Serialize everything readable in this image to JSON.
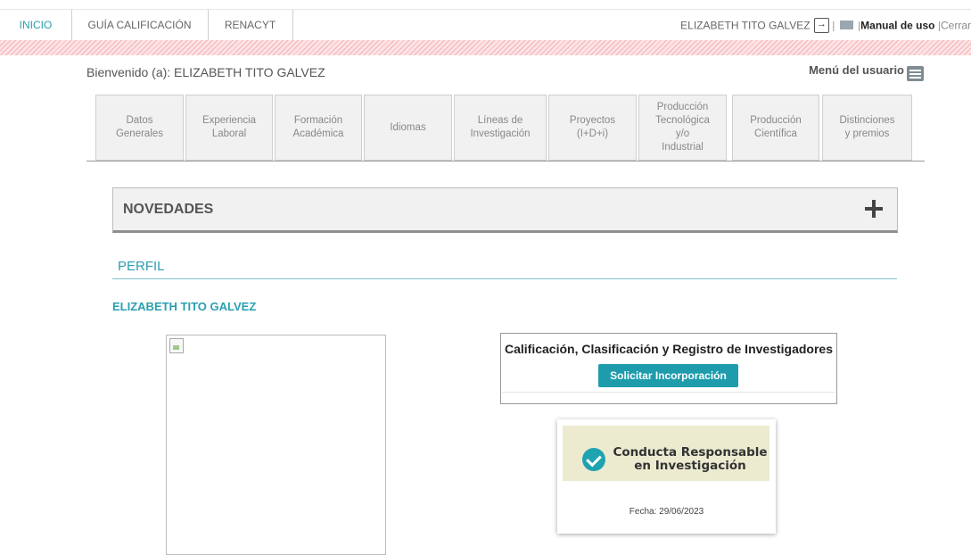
{
  "topnav": {
    "tabs": [
      "INICIO",
      "GUÍA CALIFICACIÓN",
      "RENACYT"
    ],
    "user_name": "ELIZABETH TITO GALVEZ",
    "manual": "Manual de uso",
    "close": "Cerrar"
  },
  "header": {
    "welcome": "Bienvenido (a): ELIZABETH TITO GALVEZ",
    "user_menu": "Menú del usuario"
  },
  "section_tabs": [
    {
      "line1": "Datos",
      "line2": "Generales"
    },
    {
      "line1": "Experiencia",
      "line2": "Laboral"
    },
    {
      "line1": "Formación",
      "line2": "Académica"
    },
    {
      "line1": "Idiomas",
      "line2": ""
    },
    {
      "line1": "Líneas de",
      "line2": "Investigación"
    },
    {
      "line1": "Proyectos",
      "line2": "(I+D+i)"
    },
    {
      "line1": "Producción",
      "line2": "Tecnológica",
      "line3": "y/o",
      "line4": "Industrial"
    },
    {
      "line1": "Producción",
      "line2": "Científica"
    },
    {
      "line1": "Distinciones",
      "line2": "y premios"
    }
  ],
  "novedades": {
    "title": "NOVEDADES"
  },
  "perfil": {
    "title": "PERFIL",
    "name": "ELIZABETH TITO GALVEZ"
  },
  "calificacion": {
    "title": "Calificación, Clasificación y Registro de Investigadores",
    "button": "Solicitar Incorporación"
  },
  "certificate": {
    "line1": "Conducta Responsable",
    "line2": "en Investigación",
    "date": "Fecha: 29/06/2023"
  },
  "colors": {
    "accent": "#2a9fb0",
    "button": "#1e9cab"
  }
}
